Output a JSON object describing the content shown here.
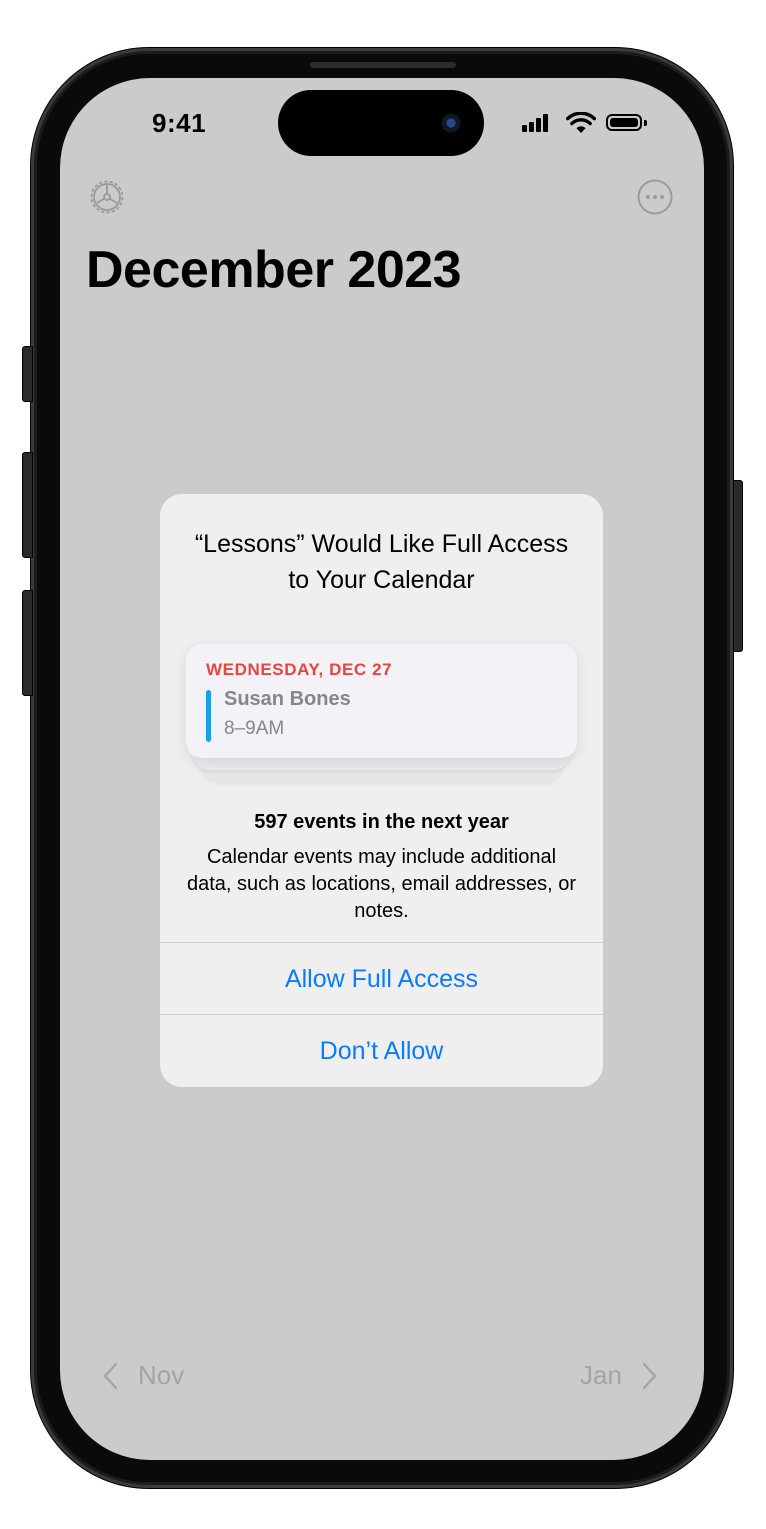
{
  "status_bar": {
    "time": "9:41"
  },
  "toolbar": {
    "settings_icon": "gear-icon",
    "more_icon": "ellipsis-circle-icon"
  },
  "header": {
    "title": "December 2023"
  },
  "dialog": {
    "title": "“Lessons” Would Like Full Access to Your Calendar",
    "event": {
      "day": "WEDNESDAY, DEC 27",
      "name": "Susan Bones",
      "time": "8–9AM"
    },
    "event_count": "597 events in the next year",
    "description": "Calendar events may include additional data, such as locations, email addresses, or notes.",
    "allow_label": "Allow Full Access",
    "deny_label": "Don’t Allow"
  },
  "footer_nav": {
    "prev_label": "Nov",
    "next_label": "Jan"
  },
  "colors": {
    "accent": "#0a7bff",
    "event_day": "#e8453c",
    "event_bar": "#1a9fe8",
    "screen_dim": "#cbcbcb"
  }
}
